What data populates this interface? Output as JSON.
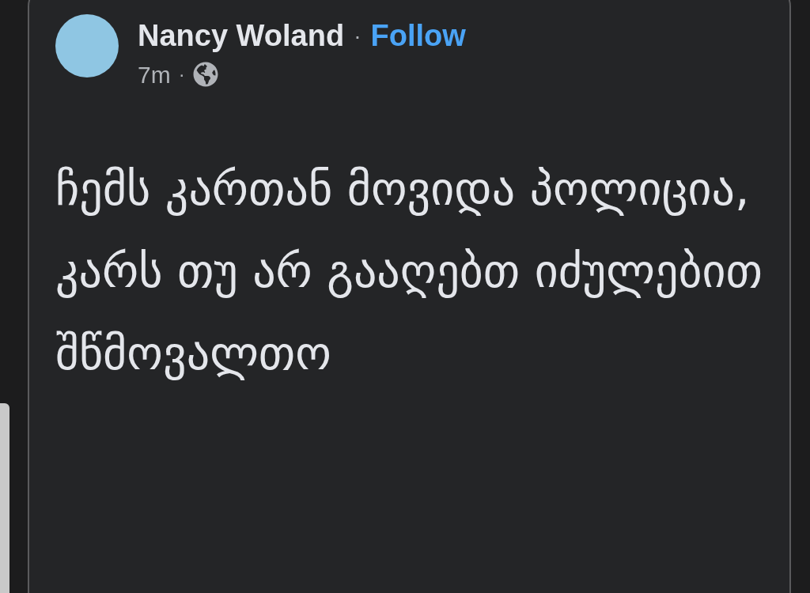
{
  "post": {
    "author": "Nancy Woland",
    "separator": "·",
    "follow": "Follow",
    "time": "7m",
    "time_separator": "·",
    "text": "ჩემს კართან მოვიდა პოლიცია, კარს თუ არ გააღებთ იძულებით შწმოვალთო"
  }
}
